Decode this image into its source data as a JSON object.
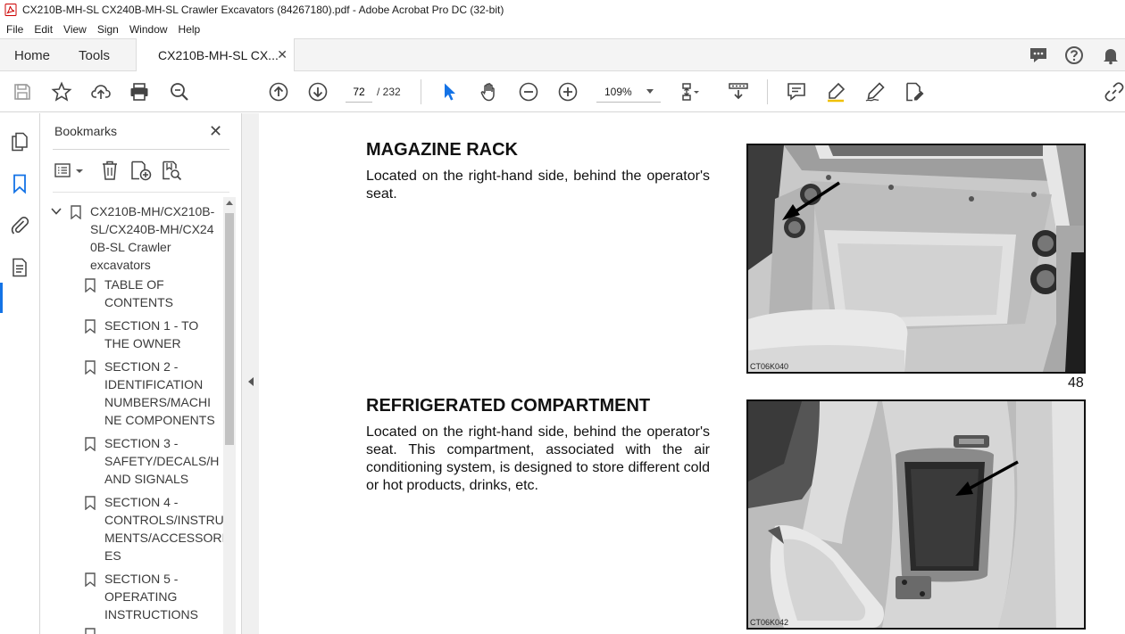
{
  "window": {
    "title": "CX210B-MH-SL CX240B-MH-SL Crawler Excavators (84267180).pdf - Adobe Acrobat Pro DC (32-bit)"
  },
  "menu": [
    "File",
    "Edit",
    "View",
    "Sign",
    "Window",
    "Help"
  ],
  "tabs": {
    "home": "Home",
    "tools": "Tools",
    "document": "CX210B-MH-SL CX..."
  },
  "toolbar": {
    "page_current": "72",
    "page_total": "/ 232",
    "zoom": "109%"
  },
  "bookmarks": {
    "title": "Bookmarks",
    "root": "CX210B-MH/CX210B-SL/CX240B-MH/CX240B-SL Crawler excavators",
    "root_lines": [
      "CX210B-MH/CX210B-",
      "SL/CX240B-MH/CX24",
      "0B-SL Crawler",
      "excavators"
    ],
    "items": [
      {
        "lines": [
          "TABLE OF",
          "CONTENTS"
        ]
      },
      {
        "lines": [
          "SECTION 1 - TO",
          "THE OWNER"
        ]
      },
      {
        "lines": [
          "SECTION 2 -",
          "IDENTIFICATION",
          "NUMBERS/MACHI",
          "NE COMPONENTS"
        ]
      },
      {
        "lines": [
          "SECTION 3 -",
          "SAFETY/DECALS/H",
          "AND SIGNALS"
        ]
      },
      {
        "lines": [
          "SECTION 4 -",
          "CONTROLS/INSTRU",
          "MENTS/ACCESSORI",
          "ES"
        ]
      },
      {
        "lines": [
          "SECTION 5 -",
          "OPERATING",
          "INSTRUCTIONS"
        ]
      }
    ]
  },
  "document": {
    "section1": {
      "heading": "MAGAZINE RACK",
      "body": "Located on the right-hand side, behind the operator's seat.",
      "photo_code": "CT06K040"
    },
    "page_number": "48",
    "section2": {
      "heading": "REFRIGERATED COMPARTMENT",
      "body": "Located on the right-hand side, behind the operator's seat. This compartment, associated with the air conditioning system, is designed to store different cold or hot products, drinks, etc.",
      "photo_code": "CT06K042"
    }
  },
  "colors": {
    "accent": "#1473e6",
    "tabbar": "#f4f4f4"
  }
}
